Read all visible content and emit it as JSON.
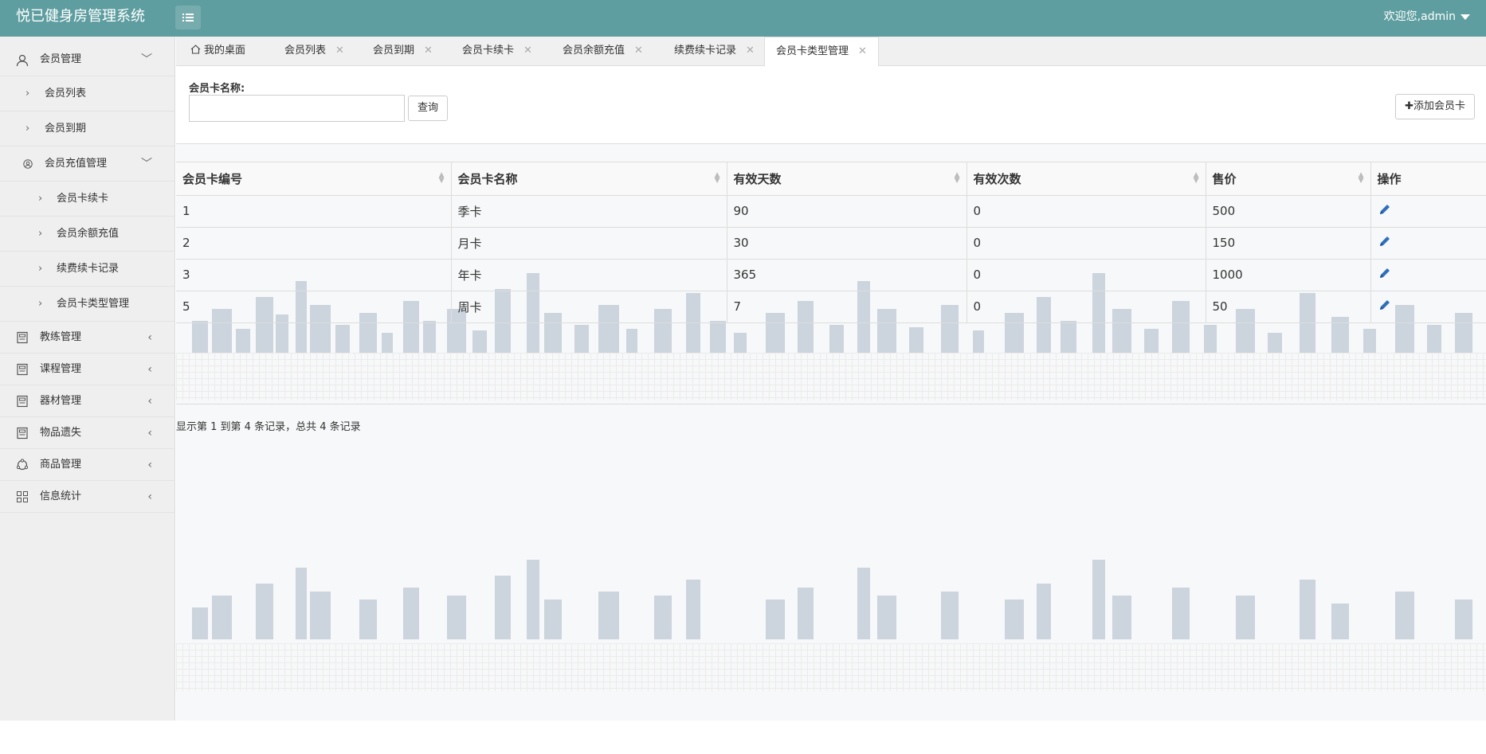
{
  "header": {
    "title": "悦已健身房管理系统",
    "user": "欢迎您,admin"
  },
  "sidebar": {
    "items": [
      {
        "label": "会员管理"
      },
      {
        "label": "会员列表"
      },
      {
        "label": "会员到期"
      },
      {
        "label": "会员充值管理"
      },
      {
        "label": "会员卡续卡"
      },
      {
        "label": "会员余额充值"
      },
      {
        "label": "续费续卡记录"
      },
      {
        "label": "会员卡类型管理"
      },
      {
        "label": "教练管理"
      },
      {
        "label": "课程管理"
      },
      {
        "label": "器材管理"
      },
      {
        "label": "物品遗失"
      },
      {
        "label": "商品管理"
      },
      {
        "label": "信息统计"
      }
    ]
  },
  "tabs": [
    {
      "label": "我的桌面"
    },
    {
      "label": "会员列表"
    },
    {
      "label": "会员到期"
    },
    {
      "label": "会员卡续卡"
    },
    {
      "label": "会员余额充值"
    },
    {
      "label": "续费续卡记录"
    },
    {
      "label": "会员卡类型管理"
    }
  ],
  "search": {
    "label": "会员卡名称:",
    "value": "",
    "query_button": "查询",
    "add_button": "✚添加会员卡"
  },
  "table": {
    "headers": [
      "会员卡编号",
      "会员卡名称",
      "有效天数",
      "有效次数",
      "售价",
      "操作"
    ],
    "rows": [
      [
        "1",
        "季卡",
        "90",
        "0",
        "500"
      ],
      [
        "2",
        "月卡",
        "30",
        "0",
        "150"
      ],
      [
        "3",
        "年卡",
        "365",
        "0",
        "1000"
      ],
      [
        "5",
        "周卡",
        "7",
        "0",
        "50"
      ]
    ]
  },
  "pagination": {
    "summary": "显示第 1 到第 4 条记录，总共 4 条记录"
  }
}
